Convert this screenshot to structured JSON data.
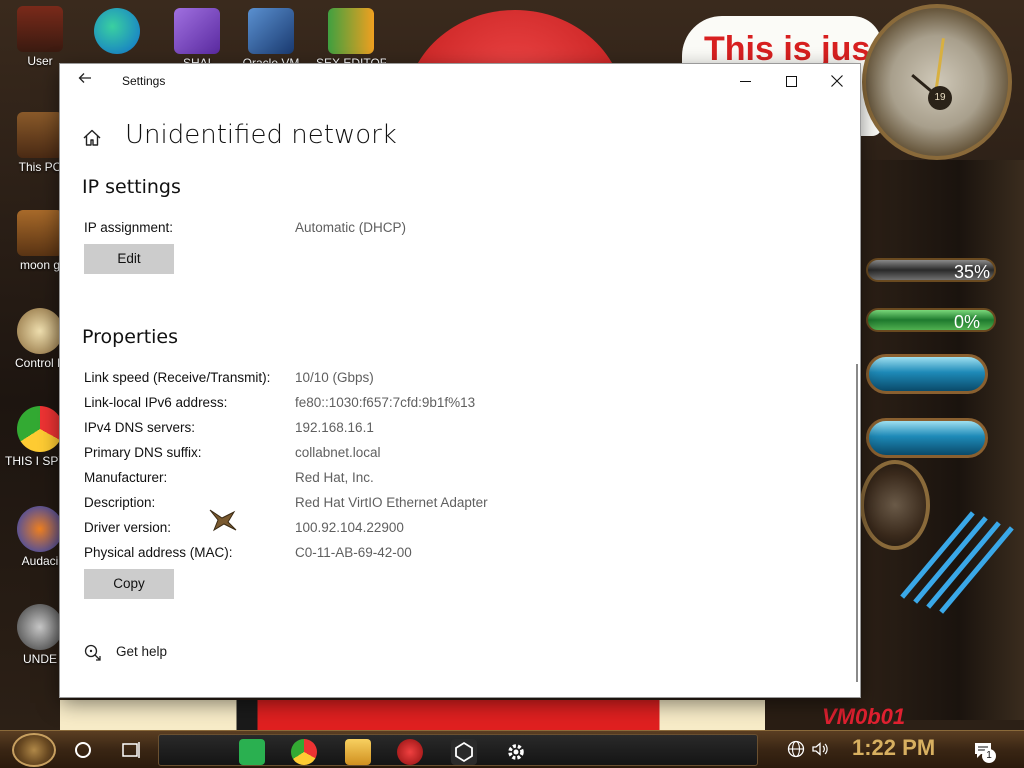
{
  "desktop": {
    "icons": [
      {
        "label": "User"
      },
      {
        "label": "This PC"
      },
      {
        "label": "moon g"
      },
      {
        "label": "Control P"
      },
      {
        "label": "THIS I SPYWA"
      },
      {
        "label": "Audaci"
      },
      {
        "label": "UNDE"
      },
      {
        "label": "SHAI"
      },
      {
        "label": "Oracle VM"
      },
      {
        "label": "SEX EDITOR"
      }
    ],
    "wallpaper_text": "This is jus",
    "gauges": [
      {
        "label": "35%"
      },
      {
        "label": "0%"
      }
    ],
    "clock_number": "19",
    "vm_badge": "VM0b01"
  },
  "window": {
    "title": "Settings",
    "back_icon": "back-arrow-icon",
    "controls": {
      "minimize": "minimize-icon",
      "maximize": "maximize-icon",
      "close": "close-icon"
    },
    "page_title": "Unidentified network",
    "ip_settings": {
      "heading": "IP settings",
      "assignment_label": "IP assignment:",
      "assignment_value": "Automatic (DHCP)",
      "edit_button": "Edit"
    },
    "properties": {
      "heading": "Properties",
      "rows": [
        {
          "key": "Link speed (Receive/Transmit):",
          "value": "10/10 (Gbps)"
        },
        {
          "key": "Link-local IPv6 address:",
          "value": "fe80::1030:f657:7cfd:9b1f%13"
        },
        {
          "key": "IPv4 DNS servers:",
          "value": "192.168.16.1"
        },
        {
          "key": "Primary DNS suffix:",
          "value": "collabnet.local"
        },
        {
          "key": "Manufacturer:",
          "value": "Red Hat, Inc."
        },
        {
          "key": "Description:",
          "value": "Red Hat VirtIO Ethernet Adapter"
        },
        {
          "key": "Driver version:",
          "value": "100.92.104.22900"
        },
        {
          "key": "Physical address (MAC):",
          "value": "C0-11-AB-69-42-00"
        }
      ],
      "copy_button": "Copy"
    },
    "help": {
      "label": "Get help",
      "icon": "help-chat-icon"
    }
  },
  "taskbar": {
    "apps": [
      "spotify-icon",
      "chrome-icon",
      "file-explorer-icon",
      "app-red-icon",
      "unity-icon",
      "settings-gear-icon"
    ],
    "time": "1:22 PM",
    "notification_count": "1"
  },
  "colors": {
    "window_bg": "#ffffff",
    "button_bg": "#cccccc",
    "value_text": "#5f5f5f",
    "clock_text": "#d8b060"
  }
}
